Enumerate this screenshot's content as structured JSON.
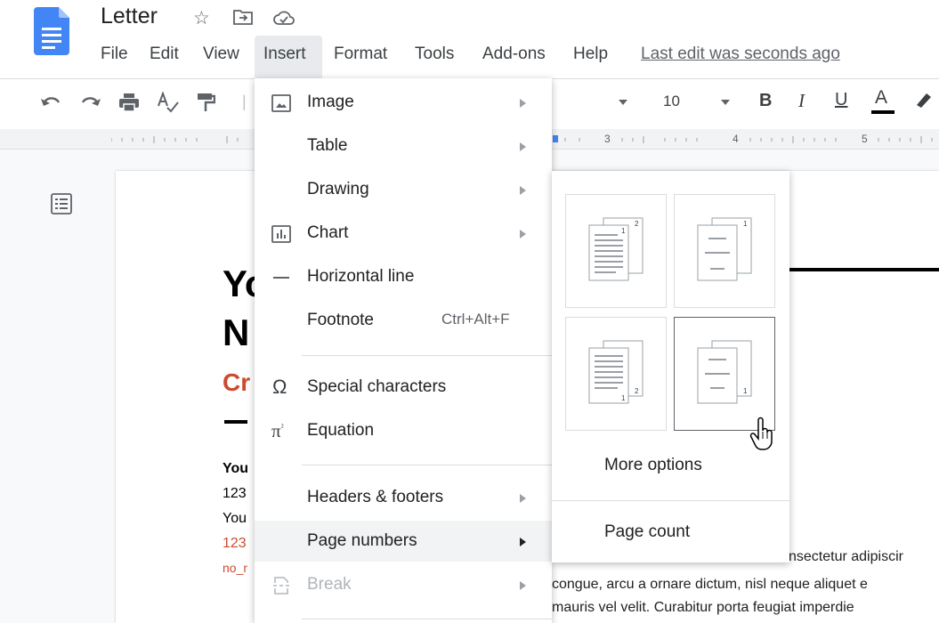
{
  "app": {
    "doc_title": "Letter",
    "last_edit": "Last edit was seconds ago"
  },
  "menubar": {
    "items": [
      "File",
      "Edit",
      "View",
      "Insert",
      "Format",
      "Tools",
      "Add-ons",
      "Help"
    ],
    "active": "Insert"
  },
  "toolbar": {
    "font_size": "10",
    "bold": "B",
    "italic": "I",
    "underline": "U",
    "text_color": "A"
  },
  "ruler": {
    "numbers": [
      "3",
      "4",
      "5"
    ]
  },
  "document": {
    "heading_a": "Yo",
    "heading_b": "N",
    "subheading": "Cr",
    "line1": "You",
    "line2": "123",
    "line3": "You",
    "line4": "123",
    "line5": "no_r",
    "body1": "nsectetur adipiscir",
    "body2": "congue, arcu a ornare dictum, nisl neque aliquet e",
    "body3": "mauris vel velit. Curabitur porta feugiat imperdie"
  },
  "insert_menu": {
    "image": "Image",
    "table": "Table",
    "drawing": "Drawing",
    "chart": "Chart",
    "horizontal_line": "Horizontal line",
    "footnote": "Footnote",
    "footnote_shortcut": "Ctrl+Alt+F",
    "special_characters": "Special characters",
    "equation": "Equation",
    "headers_footers": "Headers & footers",
    "page_numbers": "Page numbers",
    "break": "Break"
  },
  "page_numbers_submenu": {
    "more_options": "More options",
    "page_count": "Page count",
    "hovered_option": 4
  },
  "colors": {
    "doc_blue": "#4285f4",
    "accent_red": "#cc4b2f",
    "menu_hover": "#f1f3f4"
  }
}
